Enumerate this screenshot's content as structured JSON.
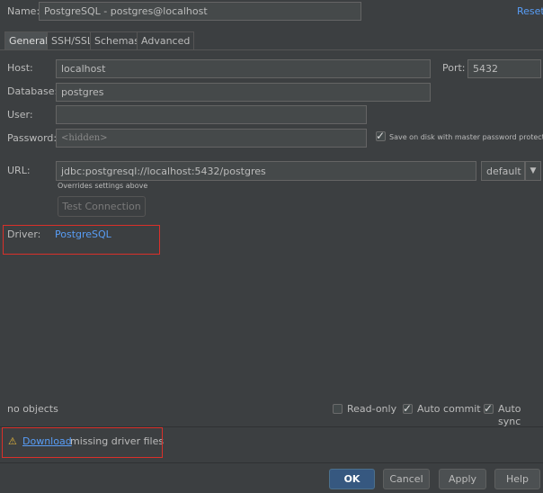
{
  "header": {
    "name_label": "Name:",
    "name_value": "PostgreSQL - postgres@localhost",
    "reset_label": "Reset"
  },
  "tabs": [
    {
      "label": "General"
    },
    {
      "label": "SSH/SSL"
    },
    {
      "label": "Schemas"
    },
    {
      "label": "Advanced"
    }
  ],
  "form": {
    "host_label": "Host:",
    "host_value": "localhost",
    "port_label": "Port:",
    "port_value": "5432",
    "database_label": "Database:",
    "database_value": "postgres",
    "user_label": "User:",
    "user_value": "",
    "password_label": "Password:",
    "password_placeholder": "<hidden>",
    "save_password_label": "Save on disk with master password protection",
    "url_label": "URL:",
    "url_value": "jdbc:postgresql://localhost:5432/postgres",
    "url_mode": "default",
    "url_hint": "Overrides settings above",
    "test_connection_label": "Test Connection",
    "driver_label": "Driver:",
    "driver_value": "PostgreSQL"
  },
  "footer": {
    "objects_text": "no objects",
    "readonly_label": "Read-only",
    "autocommit_label": "Auto commit",
    "autosync_label": "Auto sync",
    "download_link": "Download",
    "download_rest": "missing driver files",
    "ok_label": "OK",
    "cancel_label": "Cancel",
    "apply_label": "Apply",
    "help_label": "Help"
  },
  "icons": {
    "warning": "warning-icon",
    "dropdown": "chevron-down-icon",
    "check": "check-icon"
  },
  "colors": {
    "background": "#3c3f41",
    "link": "#589df6",
    "highlight_box": "#d9302a",
    "primary_button": "#365880"
  }
}
